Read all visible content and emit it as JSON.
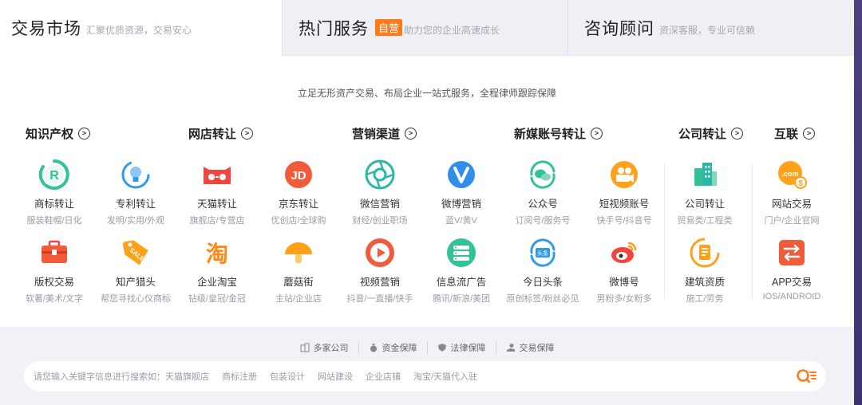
{
  "tabs": [
    {
      "title": "交易市场",
      "sub": "汇聚优质资源，交易安心",
      "badge": ""
    },
    {
      "title": "热门服务",
      "sub": "助力您的企业高速成长",
      "badge": "自营"
    },
    {
      "title": "咨询顾问",
      "sub": "资深客服，专业可信赖",
      "badge": ""
    }
  ],
  "tagline": "立足无形资产交易、布局企业一站式服务，全程律师跟踪保障",
  "categories": [
    "知识产权",
    "网店转让",
    "营销渠道",
    "新媒账号转让",
    "公司转让",
    "互联"
  ],
  "row1": [
    {
      "name": "商标转让",
      "desc": "服装鞋帽/日化",
      "icon": "trademark-icon"
    },
    {
      "name": "专利转让",
      "desc": "发明/实用/外观",
      "icon": "lightbulb-icon"
    },
    {
      "name": "天猫转让",
      "desc": "旗舰店/专营店",
      "icon": "tmall-icon"
    },
    {
      "name": "京东转让",
      "desc": "优创店/全球购",
      "icon": "jd-icon"
    },
    {
      "name": "微信营销",
      "desc": "财经/创业职场",
      "icon": "aperture-icon"
    },
    {
      "name": "微博营销",
      "desc": "蓝V/黄V",
      "icon": "v-badge-icon"
    },
    {
      "name": "公众号",
      "desc": "订阅号/服务号",
      "icon": "wechat-icon"
    },
    {
      "name": "短视频账号",
      "desc": "快手号/抖音号",
      "icon": "video-camera-icon"
    },
    {
      "name": "公司转让",
      "desc": "贸易类/工程类",
      "icon": "building-icon"
    },
    {
      "name": "网站交易",
      "desc": "门户/企业官网",
      "icon": "dotcom-icon"
    }
  ],
  "row2": [
    {
      "name": "版权交易",
      "desc": "软著/美术/文字",
      "icon": "briefcase-icon"
    },
    {
      "name": "知产猎头",
      "desc": "帮您寻找心仪商标",
      "icon": "sale-tag-icon"
    },
    {
      "name": "企业淘宝",
      "desc": "钻级/皇冠/金冠",
      "icon": "taobao-icon"
    },
    {
      "name": "蘑菇街",
      "desc": "主站/企业店",
      "icon": "mushroom-icon"
    },
    {
      "name": "视频营销",
      "desc": "抖音/一直播/快手",
      "icon": "play-icon"
    },
    {
      "name": "信息流广告",
      "desc": "腾讯/新浪/美团",
      "icon": "server-icon"
    },
    {
      "name": "今日头条",
      "desc": "原创标签/粉丝必见",
      "icon": "toutiao-icon"
    },
    {
      "name": "微博号",
      "desc": "男粉多/女粉多",
      "icon": "weibo-icon"
    },
    {
      "name": "建筑资质",
      "desc": "施工/劳务",
      "icon": "document-icon"
    },
    {
      "name": "APP交易",
      "desc": "IOS/ANDROID",
      "icon": "swap-icon"
    }
  ],
  "guarantees": [
    "多家公司",
    "资金保障",
    "法律保障",
    "交易保障"
  ],
  "search": {
    "hint": "请您输入关键字信息进行搜索如：天猫旗舰店",
    "keywords": [
      "商标注册",
      "包装设计",
      "网站建设",
      "企业店铺",
      "淘宝/天猫代入驻"
    ]
  },
  "colors": {
    "green": "#33c19a",
    "blue": "#2f9be8",
    "red": "#f2453c",
    "orange": "#ff9d1a",
    "teal": "#2bb7a6",
    "accent": "#ff7a1a"
  }
}
